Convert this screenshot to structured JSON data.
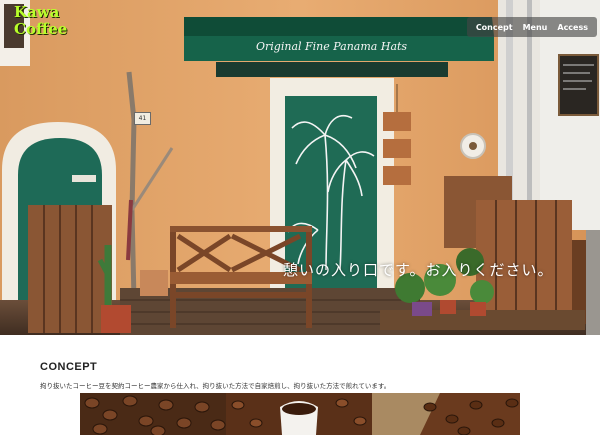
{
  "brand": {
    "line1": "Kawa",
    "line2": "Coffee"
  },
  "nav": {
    "items": [
      "Concept",
      "Menu",
      "Access"
    ]
  },
  "hero": {
    "awning_text": "Original Fine Panama Hats",
    "house_number": "41",
    "caption": "憩いの入り口です。お入りください。"
  },
  "concept": {
    "title": "CONCEPT",
    "text": "拘り抜いたコーヒー豆を契約コーヒー農家から仕入れ、拘り抜いた方法で自家焙煎し、拘り抜いた方法で煎れています。"
  },
  "icons": [
    "palm-illustration-icon",
    "coffee-cup-icon"
  ],
  "colors": {
    "facade": "#e3a76b",
    "door_green": "#1f6b55",
    "awning_green": "#13573f",
    "logo": "#b8ff2a"
  }
}
